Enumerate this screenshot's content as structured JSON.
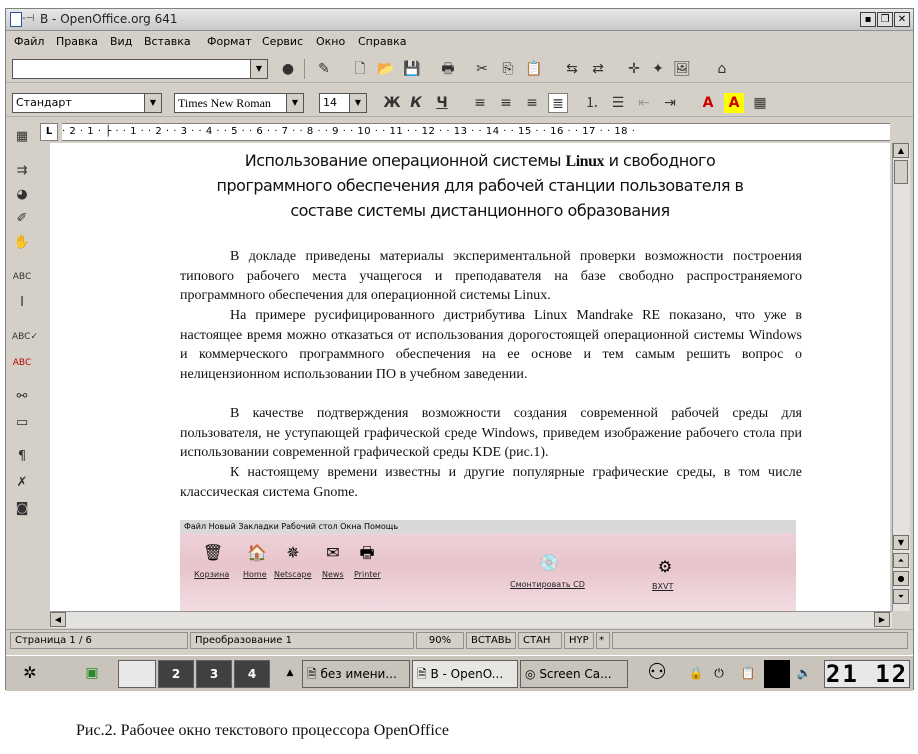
{
  "window": {
    "title": "B - OpenOffice.org 641",
    "pin_label": "-⊣"
  },
  "menu": [
    "Файл",
    "Правка",
    "Вид",
    "Вставка",
    "Формат",
    "Сервис",
    "Окно",
    "Справка"
  ],
  "format_bar": {
    "style": "Стандарт",
    "font": "Times New Roman",
    "size": "14",
    "bold": "Ж",
    "italic": "К",
    "underline": "Ч",
    "font_color": "A",
    "highlight": "A"
  },
  "ruler": {
    "corner": "L",
    "marks": "· 2 · 1 · ├ · · 1 · · 2 · · 3 · · 4 · · 5 · · 6 · · 7 · · 8 · · 9 · · 10 · · 11 · · 12 · · 13 · · 14 · · 15 · · 16 · · 17 · · 18 ·"
  },
  "document": {
    "heading1": "Использование операционной системы",
    "heading1_bold": "Linux",
    "heading1_tail": "и свободного",
    "heading2": "программного обеспечения для рабочей станции пользователя в",
    "heading3": "составе системы дистанционного образования",
    "p1": "В докладе приведены материалы экспериментальной проверки возможности построения типового рабочего места учащегося и преподавателя на базе свободно распространяемого программного обеспечения для операционной системы Linux.",
    "p2": "На примере русифицированного дистрибутива Linux Mandrake RE показано, что уже в настоящее время можно отказаться от использования дорогостоящей операционной системы Windows и коммерческого программного обеспечения на ее основе и тем самым решить вопрос о нелицензионном использовании ПО в учебном заведении.",
    "p3": "В качестве подтверждения возможности создания современной рабочей среды для пользователя, не уступающей графической среде Windows, приведем изображение рабочего стола при использовании современной графической среды KDE (рис.1).",
    "p4": "К настоящему времени известны и другие популярные графические среды, в том числе классическая система Gnome."
  },
  "embedded_shot": {
    "menu": "Файл  Новый  Закладки  Рабочий стол  Окна  Помощь",
    "icons": [
      "Корзина",
      "Home",
      "Netscape",
      "News",
      "Printer",
      "Смонтировать CD",
      "BXVT"
    ]
  },
  "status": {
    "page": "Страница  1 / 6",
    "style": "Преобразование 1",
    "zoom": "90%",
    "insert": "ВСТАВЬ",
    "std": "СТАН",
    "hyp": "HYP",
    "star": "*"
  },
  "taskbar": {
    "desktops": [
      "2",
      "3",
      "4"
    ],
    "tasks": [
      "без имени...",
      "B - OpenO...",
      "Screen Ca..."
    ],
    "clock": "21 12"
  },
  "caption": "Рис.2. Рабочее окно текстового процессора OpenOffice"
}
